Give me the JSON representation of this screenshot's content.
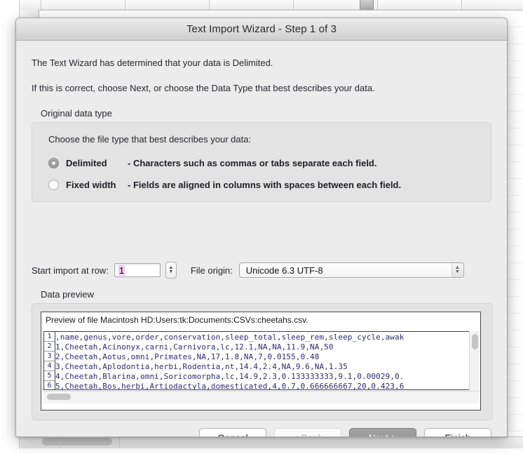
{
  "window": {
    "title": "Text Import Wizard - Step 1 of 3"
  },
  "intro": {
    "line1": "The Text Wizard has determined that your data is Delimited.",
    "line2": "If this is correct, choose Next, or choose the Data Type that best describes your data."
  },
  "original_data_type": {
    "group_label": "Original data type",
    "prompt": "Choose the file type that best describes your data:",
    "options": [
      {
        "label": "Delimited",
        "description": "- Characters such as commas or tabs separate each field.",
        "selected": true
      },
      {
        "label": "Fixed width",
        "description": "- Fields are aligned in columns with spaces between each field.",
        "selected": false
      }
    ]
  },
  "import_options": {
    "start_row_label": "Start import at row:",
    "start_row_value": "1",
    "file_origin_label": "File origin:",
    "file_origin_value": "Unicode 6.3 UTF-8"
  },
  "data_preview": {
    "label": "Data preview",
    "file_line": "Preview of file Macintosh HD:Users:tk:Documents:CSVs:cheetahs.csv.",
    "rows": [
      {
        "num": "1",
        "text": ",name,genus,vore,order,conservation,sleep_total,sleep_rem,sleep_cycle,awak"
      },
      {
        "num": "2",
        "text": "1,Cheetah,Acinonyx,carni,Carnivora,lc,12.1,NA,NA,11.9,NA,50"
      },
      {
        "num": "3",
        "text": "2,Cheetah,Aotus,omni,Primates,NA,17,1.8,NA,7,0.0155,0.48"
      },
      {
        "num": "4",
        "text": "3,Cheetah,Aplodontia,herbi,Rodentia,nt,14.4,2.4,NA,9.6,NA,1.35"
      },
      {
        "num": "5",
        "text": "4,Cheetah,Blarina,omni,Soricomorpha,lc,14.9,2.3,0.133333333,9.1,0.00029,0."
      },
      {
        "num": "6",
        "text": "5,Cheetah,Bos,herbi,Artiodactyla,domesticated,4,0.7,0.666666667,20,0.423,6"
      }
    ]
  },
  "buttons": [
    {
      "label": "Cancel",
      "state": "normal"
    },
    {
      "label": "< Back",
      "state": "disabled"
    },
    {
      "label": "Next >",
      "state": "default"
    },
    {
      "label": "Finish",
      "state": "normal"
    }
  ],
  "icons": {
    "stepper_up": "▲",
    "stepper_down": "▼",
    "select_up": "▲",
    "select_down": "▼"
  }
}
